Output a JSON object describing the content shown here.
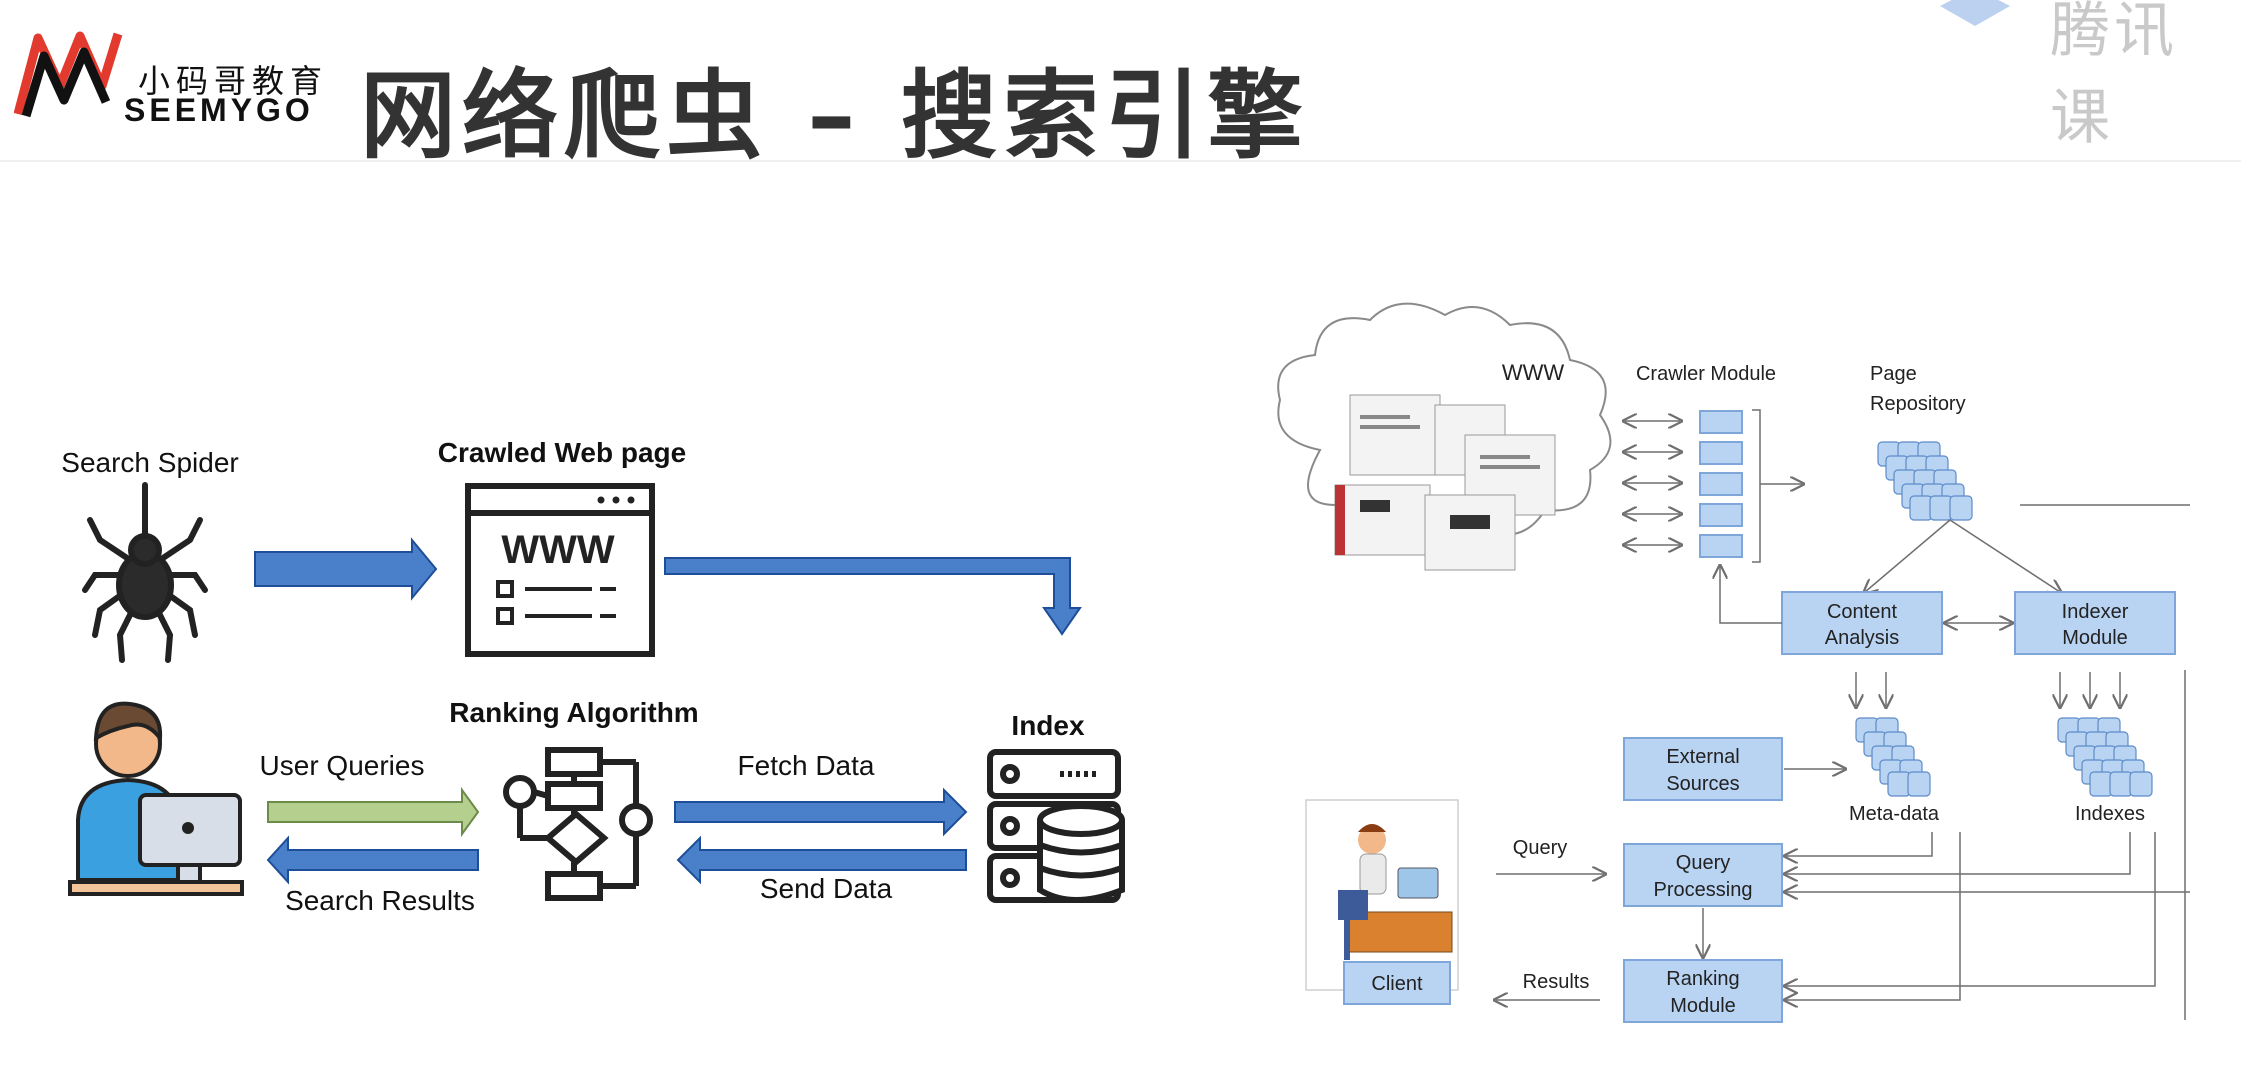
{
  "header": {
    "title": "网络爬虫 – 搜索引擎",
    "brand": {
      "name_cn": "小码哥教育",
      "name_en": "SEEMYGO"
    },
    "watermark": "腾讯课"
  },
  "left_diagram": {
    "labels": {
      "search_spider": "Search Spider",
      "crawled_page": "Crawled Web page",
      "www": "WWW",
      "ranking_algorithm": "Ranking Algorithm",
      "index": "Index",
      "user_queries": "User Queries",
      "search_results": "Search Results",
      "fetch_data": "Fetch Data",
      "send_data": "Send Data"
    },
    "colors": {
      "arrow_blue": "#4a7fc9",
      "arrow_green": "#b5cf8e",
      "icon_dark": "#222222"
    }
  },
  "right_diagram": {
    "labels": {
      "www": "WWW",
      "crawler_module": "Crawler Module",
      "page_repository": [
        "Page",
        "Repository"
      ],
      "content_analysis": [
        "Content",
        "Analysis"
      ],
      "indexer_module": [
        "Indexer",
        "Module"
      ],
      "external_sources": [
        "External",
        "Sources"
      ],
      "meta_data": "Meta-data",
      "indexes": "Indexes",
      "query": "Query",
      "query_processing": [
        "Query",
        "Processing"
      ],
      "ranking_module": [
        "Ranking",
        "Module"
      ],
      "results": "Results",
      "client": "Client"
    },
    "colors": {
      "box_fill": "#b9d4f3",
      "box_stroke": "#7ea6d8",
      "line": "#8a8a8a"
    }
  }
}
